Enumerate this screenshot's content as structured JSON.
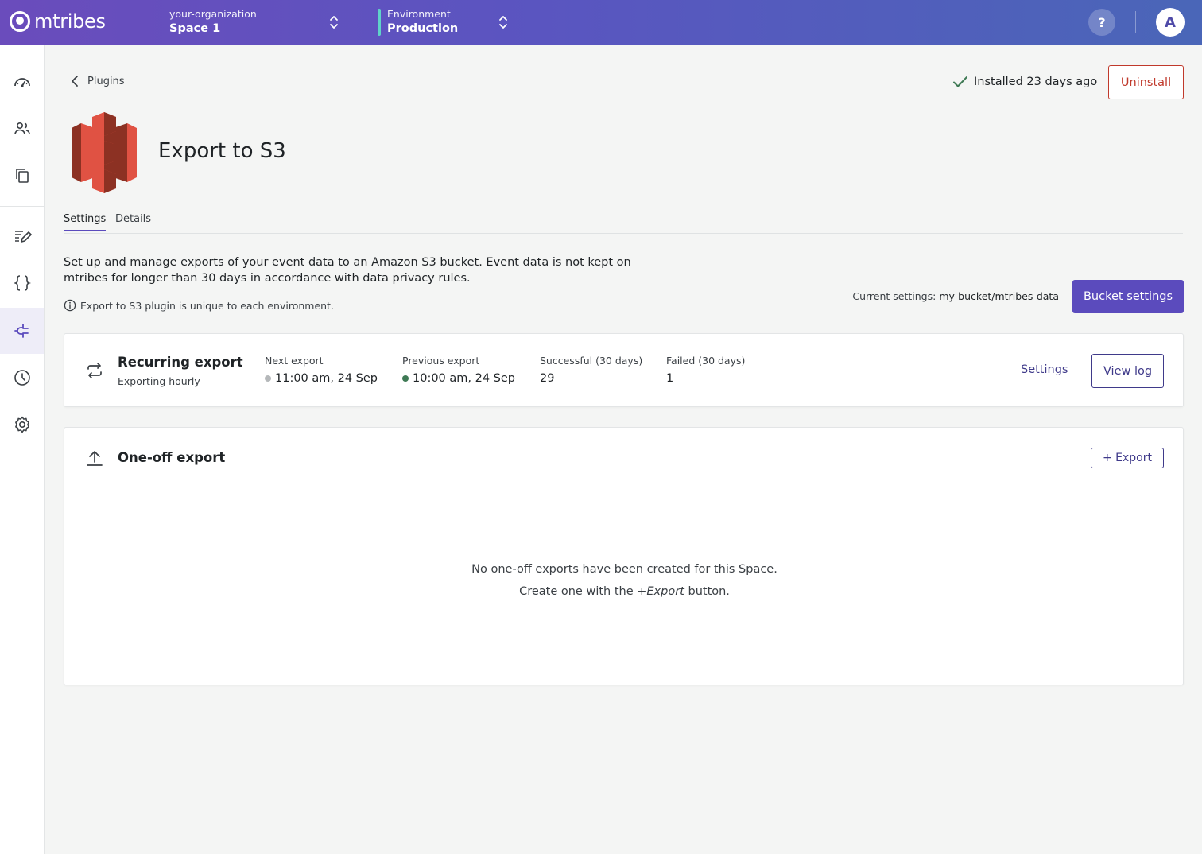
{
  "app": {
    "name": "mtribes"
  },
  "topbar": {
    "org": {
      "label": "your-organization",
      "value": "Space 1"
    },
    "env": {
      "label": "Environment",
      "value": "Production"
    },
    "help": "?",
    "avatar": "A"
  },
  "sidebar": {
    "items": [
      {
        "name": "dashboard-icon"
      },
      {
        "name": "users-icon"
      },
      {
        "name": "copy-icon"
      },
      {
        "name": "edit-icon"
      },
      {
        "name": "code-braces-icon"
      },
      {
        "name": "plugin-icon",
        "active": true
      },
      {
        "name": "clock-icon"
      },
      {
        "name": "gear-icon"
      }
    ]
  },
  "breadcrumb": {
    "back_label": "Plugins"
  },
  "status": {
    "installed": "Installed 23 days ago"
  },
  "actions": {
    "uninstall": "Uninstall"
  },
  "plugin": {
    "title": "Export to S3"
  },
  "tabs": [
    {
      "label": "Settings",
      "active": true
    },
    {
      "label": "Details"
    }
  ],
  "description": {
    "text": "Set up and manage exports of your event data to an Amazon S3 bucket. Event data is not kept on mtribes for longer than 30 days in accordance with data privacy rules.",
    "note": "Export to S3 plugin is unique to each environment."
  },
  "bucket": {
    "current_label": "Current settings:",
    "current_value": "my-bucket/mtribes-data",
    "button": "Bucket settings"
  },
  "recurring": {
    "title": "Recurring export",
    "subtitle": "Exporting hourly",
    "next": {
      "label": "Next export",
      "value": "11:00 am, 24 Sep",
      "dot_color": "#b5b8ba"
    },
    "previous": {
      "label": "Previous export",
      "value": "10:00 am, 24 Sep",
      "dot_color": "#3f7a55"
    },
    "successful": {
      "label": "Successful (30 days)",
      "value": "29"
    },
    "failed": {
      "label": "Failed (30 days)",
      "value": "1"
    },
    "settings_link": "Settings",
    "view_log": "View log"
  },
  "oneoff": {
    "title": "One-off export",
    "button": "+ Export",
    "empty_line1": "No one-off exports have been created for this Space.",
    "empty_line2_pre": "Create one with the ",
    "empty_line2_em": "+Export",
    "empty_line2_post": " button."
  },
  "colors": {
    "accent": "#5b4bbd",
    "danger": "#c0392b",
    "success": "#3f7a55"
  }
}
